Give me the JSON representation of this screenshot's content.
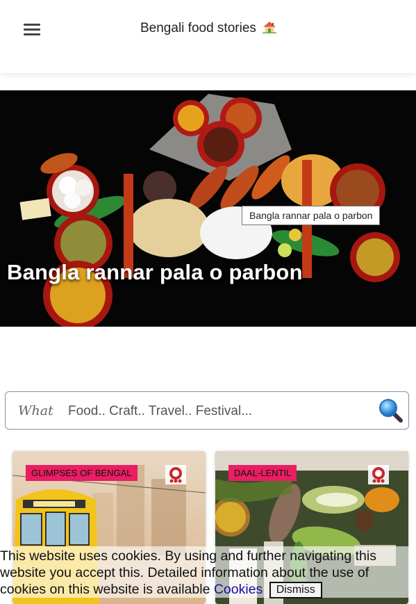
{
  "header": {
    "title": "Bengali food stories",
    "menu_icon": "hamburger-menu-icon",
    "title_icon": "house-icon"
  },
  "hero": {
    "caption": "Bangla rannar pala o parbon",
    "tooltip": "Bangla rannar pala o parbon"
  },
  "search": {
    "label": "What",
    "placeholder": "Food.. Craft.. Travel.. Festival...",
    "button_icon": "magnifier-search-icon"
  },
  "cards": [
    {
      "tag": "GLIMPSES OF BENGAL",
      "image": "kolkata-tram"
    },
    {
      "tag": "DAAL-LENTIL",
      "image": "lentils-vegetables"
    }
  ],
  "cookie": {
    "text": "This website uses cookies. By using and further navigating this website you accept this. Detailed information about the use of cookies on this website is available",
    "link_label": "Cookies",
    "dismiss_label": "Dismiss"
  },
  "colors": {
    "tag_background": "#e91e63",
    "hero_background": "#050505",
    "link": "#1a0dab"
  }
}
